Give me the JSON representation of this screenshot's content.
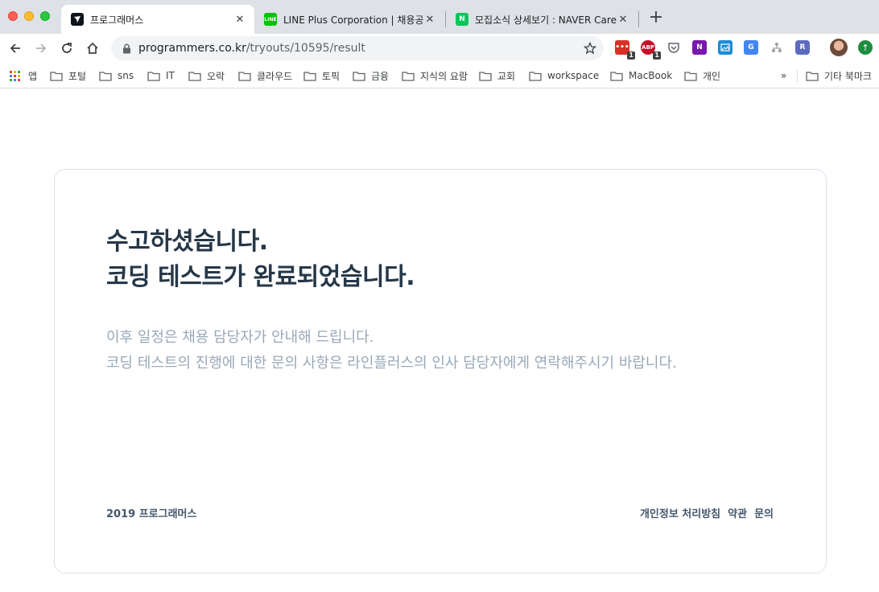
{
  "browser": {
    "tabs": [
      {
        "title": "프로그래머스",
        "favicon": "programmers-icon",
        "favicon_color": "#0c151c",
        "active": true
      },
      {
        "title": "LINE Plus Corporation | 채용공고",
        "favicon": "line-icon",
        "favicon_color": "#00c300",
        "active": false
      },
      {
        "title": "모집소식 상세보기 : NAVER Career",
        "favicon": "naver-icon",
        "favicon_color": "#03c75a",
        "active": false
      }
    ],
    "new_tab_label": "+",
    "url_host": "programmers.co.kr",
    "url_path": "/tryouts/10595/result",
    "extensions": [
      {
        "name": "todo-extension-icon",
        "label": "•••",
        "color": "#d93025",
        "badge": "1"
      },
      {
        "name": "adblock-icon",
        "label": "ABP",
        "color": "#c70d2c",
        "badge": "1"
      },
      {
        "name": "pocket-icon",
        "label": "",
        "color": "#5f6368",
        "badge": ""
      },
      {
        "name": "onenote-icon",
        "label": "N",
        "color": "#7719aa",
        "badge": ""
      },
      {
        "name": "screenshot-icon",
        "label": "",
        "color": "#1a8cd8",
        "badge": ""
      },
      {
        "name": "translate-icon",
        "label": "G",
        "color": "#4285f4",
        "badge": ""
      },
      {
        "name": "sitemap-icon",
        "label": "",
        "color": "#9aa0a6",
        "badge": ""
      },
      {
        "name": "r-extension-icon",
        "label": "R",
        "color": "#5c6bc0",
        "badge": ""
      }
    ],
    "bookmarks": {
      "apps_label": "앱",
      "items": [
        "포털",
        "sns",
        "IT",
        "오락",
        "클라우드",
        "토픽",
        "금융",
        "지식의 요람",
        "교회",
        "workspace",
        "MacBook",
        "개인"
      ],
      "overflow": "»",
      "other": "기타 북마크"
    }
  },
  "page": {
    "headline_line1": "수고하셨습니다.",
    "headline_line2": "코딩 테스트가 완료되었습니다.",
    "desc_line1": "이후 일정은 채용 담당자가 안내해 드립니다.",
    "desc_line2": "코딩 테스트의 진행에 대한 문의 사항은 라인플러스의 인사 담당자에게 연락해주시기 바랍니다.",
    "footer_copyright": "2019 프로그래머스",
    "footer_links": [
      "개인정보 처리방침",
      "약관",
      "문의"
    ]
  },
  "colors": {
    "headline": "#263747",
    "description": "#98a8b9",
    "footer": "#44576c",
    "card_border": "#d7e2eb"
  }
}
